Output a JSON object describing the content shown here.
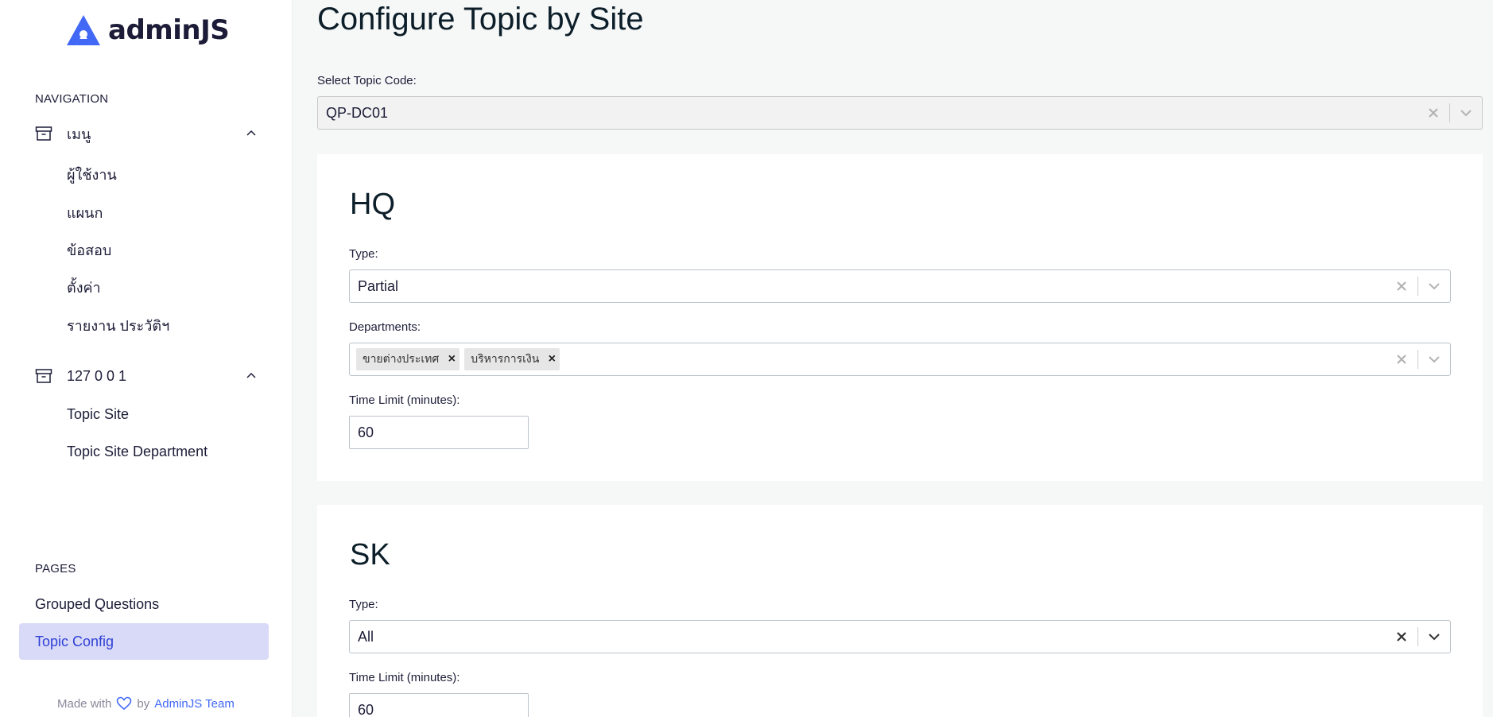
{
  "brand": {
    "name": "adminJS"
  },
  "sidebar": {
    "navigation_label": "NAVIGATION",
    "groups": [
      {
        "label": "เมนู",
        "items": [
          "ผู้ใช้งาน",
          "แผนก",
          "ข้อสอบ",
          "ตั้งค่า",
          "รายงาน ประวัติฯ"
        ]
      },
      {
        "label": "127 0 0 1",
        "items": [
          "Topic Site",
          "Topic Site Department"
        ]
      }
    ],
    "pages_label": "PAGES",
    "pages": [
      "Grouped Questions",
      "Topic Config"
    ],
    "active_page": "Topic Config",
    "footer": {
      "made_with": "Made with",
      "by": "by",
      "team": "AdminJS Team"
    }
  },
  "main": {
    "title": "Configure Topic by Site",
    "topic_select": {
      "label": "Select Topic Code:",
      "value": "QP-DC01"
    },
    "sites": [
      {
        "name": "HQ",
        "type_label": "Type:",
        "type_value": "Partial",
        "departments_label": "Departments:",
        "departments": [
          "ขายต่างประเทศ",
          "บริหารการเงิน"
        ],
        "time_limit_label": "Time Limit (minutes):",
        "time_limit": "60"
      },
      {
        "name": "SK",
        "type_label": "Type:",
        "type_value": "All",
        "time_limit_label": "Time Limit (minutes):",
        "time_limit": "60"
      }
    ]
  },
  "colors": {
    "accent": "#3040d6",
    "active_bg": "#d9daf7",
    "logo_blue": "#4268f6",
    "page_bg": "#f6f7f7"
  },
  "icons": {
    "logo": "adminjs-logo-icon",
    "group": "archive-box-icon",
    "collapse": "chevron-up-icon",
    "clear": "close-icon",
    "dropdown": "chevron-down-icon",
    "heart": "heart-icon"
  }
}
